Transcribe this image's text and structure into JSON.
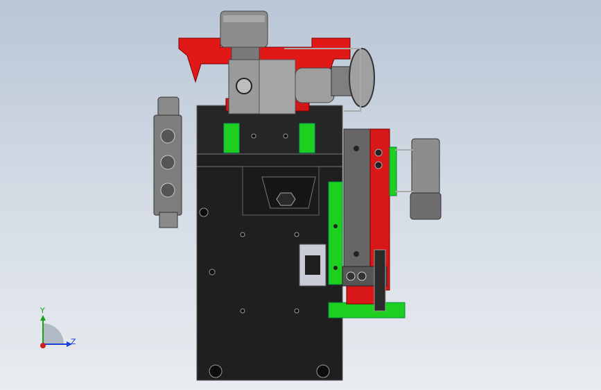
{
  "view": {
    "background": [
      "#b9c6d6",
      "#e9ecf0"
    ]
  },
  "triad": {
    "y_label": "Y",
    "z_label": "Z",
    "y_color": "#1aa11a",
    "z_color": "#1b3fd6",
    "x_color": "#d02020"
  },
  "colors": {
    "body": "#1e1e1e",
    "body_edge": "#555555",
    "red": "#e01818",
    "green": "#1fcf1f",
    "steel": "#8a8a8a",
    "steel_light": "#b8b8b8"
  }
}
